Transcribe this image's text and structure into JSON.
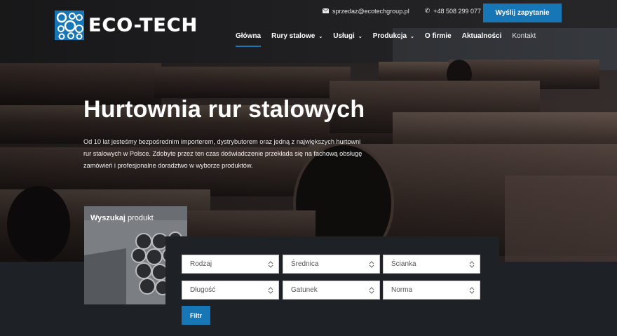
{
  "topbar": {
    "email": "sprzedaz@ecotechgroup.pl",
    "phone": "+48 508 299 077",
    "cta_label": "Wyślij zapytanie"
  },
  "logo": {
    "text": "ECO-TECH"
  },
  "nav": {
    "items": [
      {
        "label": "Główna"
      },
      {
        "label": "Rury stalowe"
      },
      {
        "label": "Usługi"
      },
      {
        "label": "Produkcja"
      },
      {
        "label": "O firmie"
      },
      {
        "label": "Aktualności"
      },
      {
        "label": "Kontakt"
      }
    ]
  },
  "hero": {
    "title": "Hurtownia rur stalowych",
    "description": "Od 10 lat jesteśmy bezpośrednim importerem, dystrybutorem oraz jedną z największych hurtowni rur stalowych w Polsce. Zdobyte przez ten czas doświadczenie przekłada się na fachową obsługę zamówień i profesjonalne doradztwo w wyborze produktów."
  },
  "search": {
    "title_bold": "Wyszukaj",
    "title_rest": " produkt",
    "selects": [
      {
        "value": "Rodzaj"
      },
      {
        "value": "Średnica"
      },
      {
        "value": "Ścianka"
      },
      {
        "value": "Długość"
      },
      {
        "value": "Gatunek"
      },
      {
        "value": "Norma"
      }
    ],
    "filter_label": "Filtr"
  },
  "colors": {
    "accent": "#1776b5",
    "dark": "#1e2226"
  }
}
